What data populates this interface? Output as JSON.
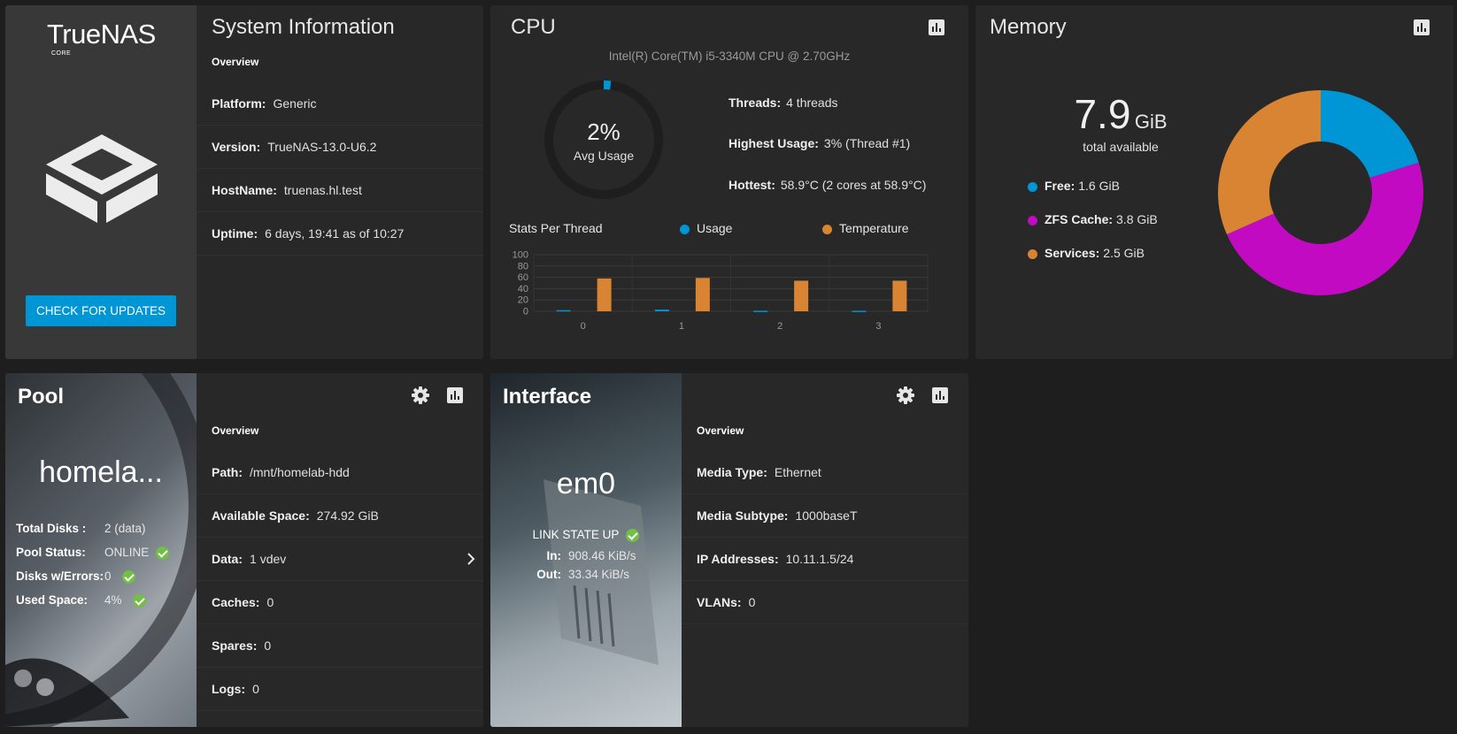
{
  "colors": {
    "accent": "#0095d5",
    "free": "#0095d5",
    "zfs": "#c10ac1",
    "services": "#d88432",
    "ok": "#71bf44"
  },
  "sysinfo": {
    "logo_main": "TrueNAS",
    "logo_sub": "CORE",
    "title": "System Information",
    "overview": "Overview",
    "update_label": "CHECK FOR UPDATES",
    "rows": [
      {
        "label": "Platform:",
        "value": "Generic"
      },
      {
        "label": "Version:",
        "value": "TrueNAS-13.0-U6.2"
      },
      {
        "label": "HostName:",
        "value": "truenas.hl.test"
      },
      {
        "label": "Uptime:",
        "value": "6 days, 19:41 as of 10:27"
      }
    ]
  },
  "cpu": {
    "title": "CPU",
    "model": "Intel(R) Core(TM) i5-3340M CPU @ 2.70GHz",
    "avg_usage_percent": 2,
    "avg_value": "2%",
    "avg_label": "Avg Usage",
    "threads_label": "Threads:",
    "threads_value": "4 threads",
    "highest_label": "Highest Usage:",
    "highest_value": "3%  (Thread #1)",
    "hottest_label": "Hottest:",
    "hottest_value": "58.9°C  (2 cores at 58.9°C)",
    "stats_label": "Stats Per Thread",
    "legend_usage": "Usage",
    "legend_temp": "Temperature"
  },
  "chart_data": {
    "type": "bar",
    "categories": [
      "0",
      "1",
      "2",
      "3"
    ],
    "series": [
      {
        "name": "Usage",
        "values": [
          2,
          3,
          1,
          1
        ]
      },
      {
        "name": "Temperature",
        "values": [
          58,
          58.9,
          54,
          54
        ]
      }
    ],
    "yticks": [
      "100",
      "80",
      "60",
      "40",
      "20",
      "0"
    ],
    "ylim": [
      0,
      100
    ]
  },
  "memory": {
    "title": "Memory",
    "total_value": "7.9",
    "total_unit": "GiB",
    "total_label": "total available",
    "free_label": "Free:",
    "free_value": "1.6 GiB",
    "zfs_label": "ZFS Cache:",
    "zfs_value": "3.8 GiB",
    "services_label": "Services:",
    "services_value": "2.5 GiB",
    "donut": [
      1.6,
      3.8,
      2.5
    ]
  },
  "pool": {
    "title": "Pool",
    "name": "homela...",
    "total_disks_label": "Total Disks :",
    "total_disks_value": "2 (data)",
    "status_label": "Pool Status:",
    "status_value": "ONLINE",
    "errors_label": "Disks w/Errors:",
    "errors_value": "0",
    "used_label": "Used Space:",
    "used_value": "4%",
    "overview": "Overview",
    "rows": [
      {
        "label": "Path:",
        "value": "/mnt/homelab-hdd"
      },
      {
        "label": "Available Space:",
        "value": "274.92  GiB"
      },
      {
        "label": "Data:",
        "value": "1 vdev"
      },
      {
        "label": "Caches:",
        "value": "0"
      },
      {
        "label": "Spares:",
        "value": "0"
      },
      {
        "label": "Logs:",
        "value": "0"
      }
    ]
  },
  "iface": {
    "title": "Interface",
    "name": "em0",
    "link_state": "LINK STATE UP",
    "in_label": "In:",
    "in_value": "908.46 KiB/s",
    "out_label": "Out:",
    "out_value": "33.34 KiB/s",
    "overview": "Overview",
    "rows": [
      {
        "label": "Media Type:",
        "value": "Ethernet"
      },
      {
        "label": "Media Subtype:",
        "value": "1000baseT"
      },
      {
        "label": "IP Addresses:",
        "value": "10.11.1.5/24"
      },
      {
        "label": "VLANs:",
        "value": "0"
      }
    ]
  }
}
